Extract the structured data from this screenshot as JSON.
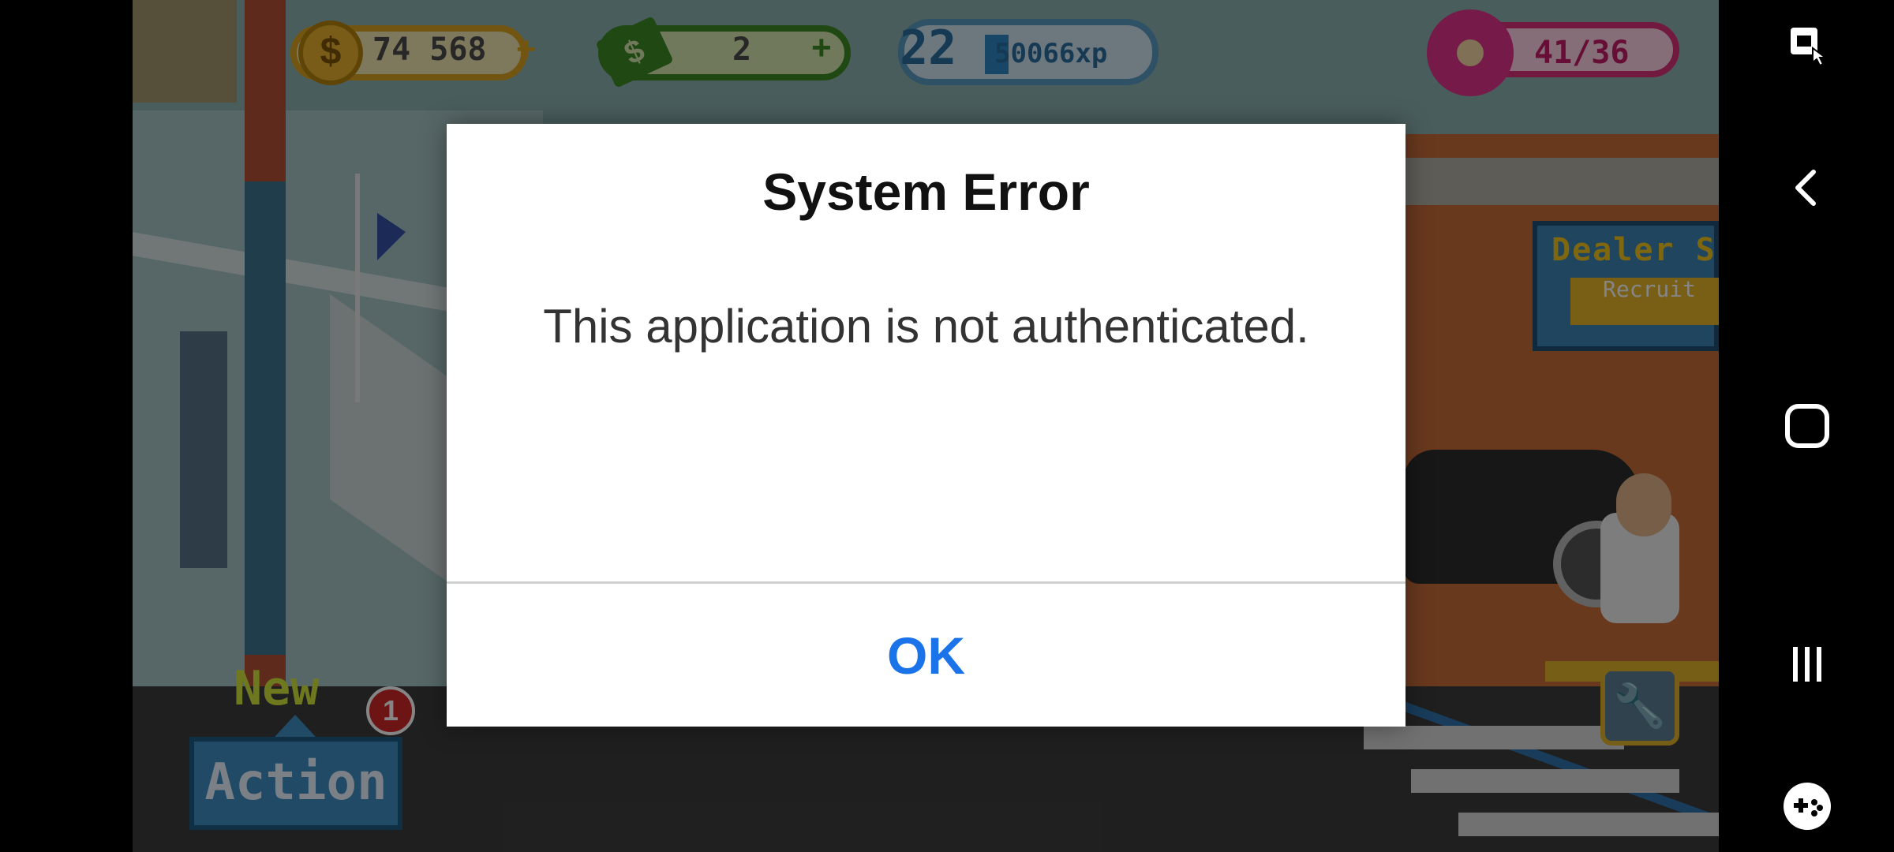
{
  "hud": {
    "coins": "74 568",
    "coins_plus": "+",
    "cash": "2",
    "cash_plus": "+",
    "level": "22",
    "xp": "50066xp",
    "energy": "41/36"
  },
  "scene": {
    "dealer_sign_title": "Dealer S",
    "dealer_sign_button": "Recruit",
    "new_label": "New",
    "new_badge_count": "1",
    "action_button": "Action"
  },
  "dialog": {
    "title": "System Error",
    "message": "This application is not authenticated.",
    "ok_label": "OK"
  },
  "navbar": {
    "icons": [
      "screenshot-touch-icon",
      "back-icon",
      "home-icon",
      "recents-icon",
      "game-tools-icon"
    ]
  },
  "colors": {
    "dialog_bg": "#ffffff",
    "ok_button": "#1a73e8",
    "navbar_bg": "#000000"
  }
}
